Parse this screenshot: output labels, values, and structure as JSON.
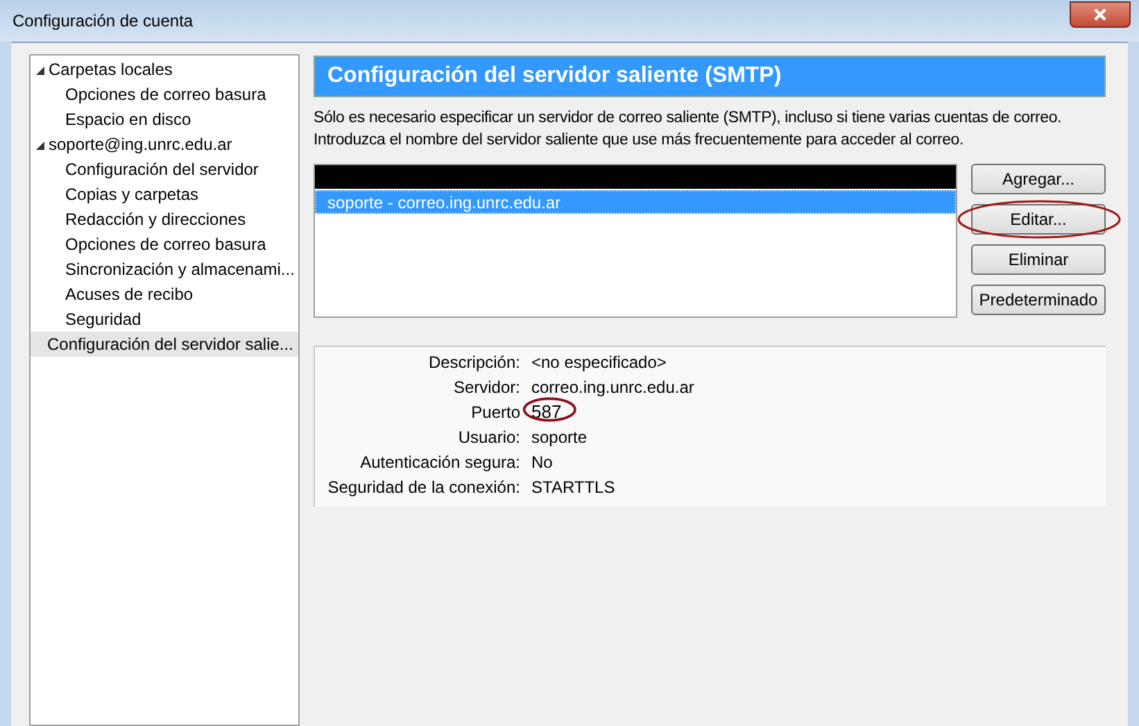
{
  "window": {
    "title": "Configuración de cuenta"
  },
  "sidebar": {
    "items": [
      {
        "label": "Carpetas locales",
        "expanded": true,
        "selected": false,
        "children": [
          {
            "label": "Opciones de correo basura",
            "selected": false
          },
          {
            "label": "Espacio en disco",
            "selected": false
          }
        ]
      },
      {
        "label": "soporte@ing.unrc.edu.ar",
        "expanded": true,
        "selected": false,
        "children": [
          {
            "label": "Configuración del servidor",
            "selected": false
          },
          {
            "label": "Copias y carpetas",
            "selected": false
          },
          {
            "label": "Redacción y direcciones",
            "selected": false
          },
          {
            "label": "Opciones de correo basura",
            "selected": false
          },
          {
            "label": "Sincronización y almacenami...",
            "selected": false
          },
          {
            "label": "Acuses de recibo",
            "selected": false
          },
          {
            "label": "Seguridad",
            "selected": false
          }
        ]
      },
      {
        "label": "Configuración del servidor salie...",
        "selected": true
      }
    ]
  },
  "panel": {
    "title": "Configuración del servidor saliente (SMTP)",
    "description": "Sólo es necesario especificar un servidor de correo saliente (SMTP), incluso si tiene varias cuentas de correo. Introduzca el nombre del servidor saliente que use más frecuentemente para acceder al correo.",
    "servers": [
      {
        "label": "soporte - correo.ing.unrc.edu.ar",
        "selected": true
      }
    ],
    "buttons": [
      {
        "label": "Agregar...",
        "circled": false
      },
      {
        "label": "Editar...",
        "circled": true
      },
      {
        "label": "Eliminar",
        "circled": false
      },
      {
        "label": "Predeterminado",
        "circled": false
      }
    ],
    "details": [
      {
        "label": "Descripción:",
        "value": "<no especificado>",
        "circled": false
      },
      {
        "label": "Servidor:",
        "value": "correo.ing.unrc.edu.ar",
        "circled": false
      },
      {
        "label": "Puerto",
        "value": "587",
        "circled": true
      },
      {
        "label": "Usuario:",
        "value": "soporte",
        "circled": false
      },
      {
        "label": "Autenticación segura:",
        "value": "No",
        "circled": false
      },
      {
        "label": "Seguridad de la conexión:",
        "value": "STARTTLS",
        "circled": false
      }
    ]
  }
}
